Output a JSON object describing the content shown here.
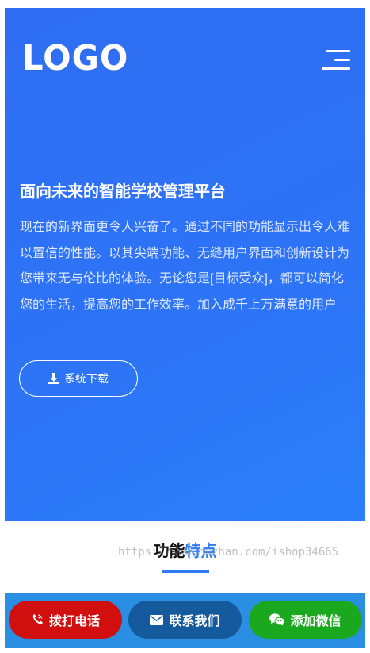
{
  "header": {
    "logo_text": "LOGO",
    "menu_icon": "hamburger-menu-icon"
  },
  "hero": {
    "title": "面向未来的智能学校管理平台",
    "description": "现在的新界面更令人兴奋了。通过不同的功能显示出令人难以置信的性能。以其尖端功能、无缝用户界面和创新设计为您带来无与伦比的体验。无论您是[目标受众]，都可以简化您的生活，提高您的工作效率。加入成千上万满意的用户",
    "download_label": "系统下载",
    "download_icon": "download-icon"
  },
  "features": {
    "title_main": "功能",
    "title_accent": "特点",
    "watermark": "https://www.huzhan.com/ishop34665"
  },
  "bottom_bar": {
    "call_label": "拨打电话",
    "call_icon": "phone-icon",
    "contact_label": "联系我们",
    "contact_icon": "envelope-icon",
    "wechat_label": "添加微信",
    "wechat_icon": "wechat-icon"
  },
  "colors": {
    "hero_blue": "#2d73f6",
    "accent_blue": "#2d7cf6",
    "bar_blue": "#2a8fe3",
    "call_red": "#d10f0f",
    "contact_navy": "#145a9c",
    "wechat_green": "#1aa81f"
  }
}
